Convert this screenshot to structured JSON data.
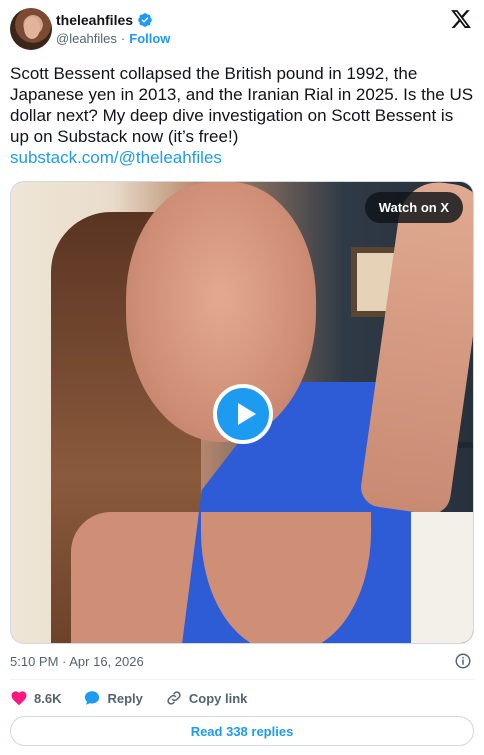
{
  "author": {
    "name": "theleahfiles",
    "handle": "@leahfiles",
    "separator": "·",
    "follow_label": "Follow"
  },
  "tweet": {
    "text": "Scott Bessent collapsed the British pound in 1992, the Japanese yen in 2013, and the Iranian Rial in 2025. Is the US dollar next? My deep dive investigation on Scott Bessent is up on Substack now (it’s free!)",
    "link": "substack.com/@theleahfiles"
  },
  "media": {
    "watch_label": "Watch on X"
  },
  "meta": {
    "timestamp": "5:10 PM · Apr 16, 2026"
  },
  "actions": {
    "like_count": "8.6K",
    "reply_label": "Reply",
    "copy_label": "Copy link"
  },
  "replies": {
    "label": "Read 338 replies"
  },
  "colors": {
    "accent": "#1d9bf0",
    "like": "#f91880",
    "text": "#0f1419",
    "muted": "#536471"
  }
}
